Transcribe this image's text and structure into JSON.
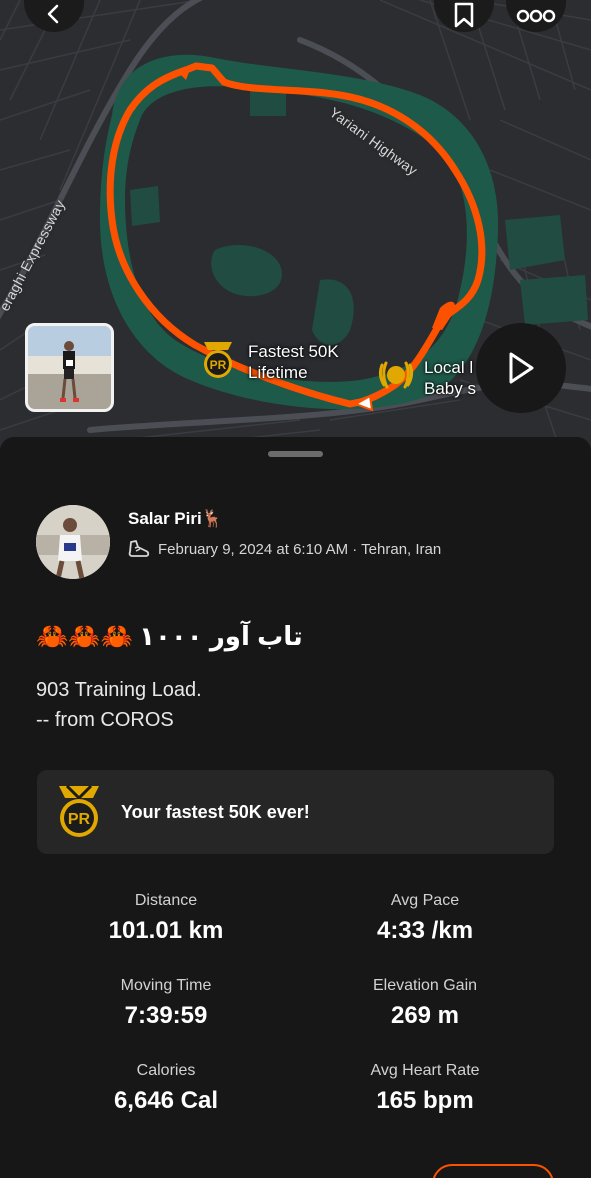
{
  "map": {
    "roads": {
      "highway_label": "Yariani Highway",
      "expressway_label": "eraghi Expressway"
    },
    "callouts": {
      "fastest_title": "Fastest 50K",
      "fastest_sub": "Lifetime",
      "pr_badge": "PR",
      "local_title": "Local l",
      "local_sub": "Baby s"
    },
    "colors": {
      "route": "#fc5200",
      "park": "#1e5a4a",
      "background": "#2b2d31"
    }
  },
  "header": {
    "back_icon": "chevron-left-icon",
    "bookmark_icon": "bookmark-icon",
    "more_icon": "more-icon",
    "play_icon": "play-icon"
  },
  "athlete": {
    "name": "Salar Piri🦌",
    "date_location": "February 9, 2024 at 6:10 AM · Tehran, Iran",
    "activity_icon": "shoe-icon"
  },
  "activity": {
    "crabs": "🦀🦀🦀",
    "title": "تاب آور ۱۰۰۰",
    "description_line1": "903 Training Load.",
    "description_line2": "-- from COROS"
  },
  "achievement": {
    "badge": "PR",
    "text": "Your fastest 50K ever!"
  },
  "stats": [
    {
      "label": "Distance",
      "value": "101.01 km"
    },
    {
      "label": "Avg Pace",
      "value": "4:33 /km"
    },
    {
      "label": "Moving Time",
      "value": "7:39:59"
    },
    {
      "label": "Elevation Gain",
      "value": "269 m"
    },
    {
      "label": "Calories",
      "value": "6,646 Cal"
    },
    {
      "label": "Avg Heart Rate",
      "value": "165 bpm"
    }
  ],
  "colors": {
    "accent": "#fc5200",
    "gold": "#e0a800",
    "sheet_bg": "#171717",
    "card_bg": "#262626"
  }
}
